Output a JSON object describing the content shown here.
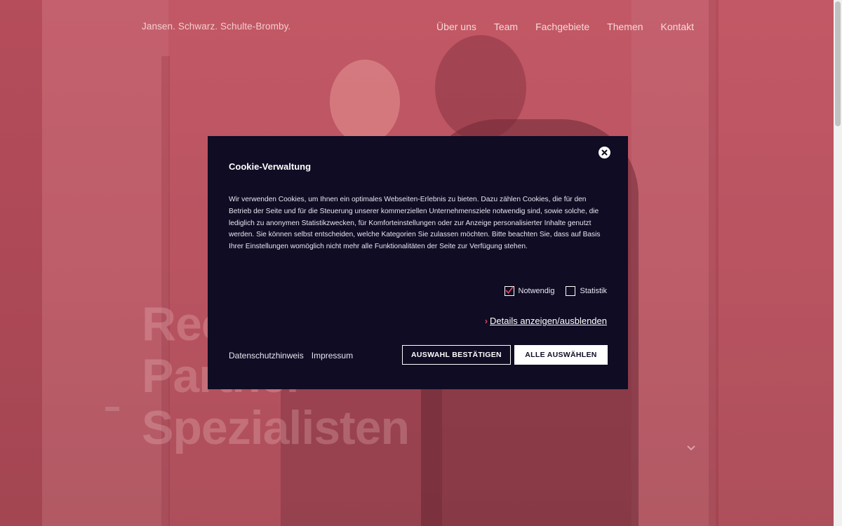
{
  "header": {
    "brand": "Jansen. Schwarz. Schulte-Bromby.",
    "nav": [
      "Über uns",
      "Team",
      "Fachgebiete",
      "Themen",
      "Kontakt"
    ]
  },
  "hero": {
    "lines": [
      "Rec",
      "Partner",
      "Spezialisten"
    ]
  },
  "cookie_modal": {
    "title": "Cookie-Verwaltung",
    "text": "Wir verwenden Cookies, um Ihnen ein optimales Webseiten-Erlebnis zu bieten. Dazu zählen Cookies, die für den Betrieb der Seite und für die Steuerung unserer kommerziellen Unternehmensziele notwendig sind, sowie solche, die lediglich zu anonymen Statistikzwecken, für Komforteinstellungen oder zur Anzeige personalisierter Inhalte genutzt werden. Sie können selbst entscheiden, welche Kategorien Sie zulassen möchten. Bitte beachten Sie, dass auf Basis Ihrer Einstellungen womöglich nicht mehr alle Funktionalitäten der Seite zur Verfügung stehen.",
    "checkboxes": [
      {
        "label": "Notwendig",
        "checked": true
      },
      {
        "label": "Statistik",
        "checked": false
      }
    ],
    "details_link": "Details anzeigen/ausblenden",
    "links": [
      "Datenschutzhinweis",
      "Impressum"
    ],
    "buttons": {
      "confirm": "AUSWAHL BESTÄTIGEN",
      "select_all": "ALLE AUSWÄHLEN"
    }
  },
  "colors": {
    "hero_overlay": "#b85560",
    "modal_bg": "#0f0c24",
    "check_accent": "#e0455b"
  }
}
